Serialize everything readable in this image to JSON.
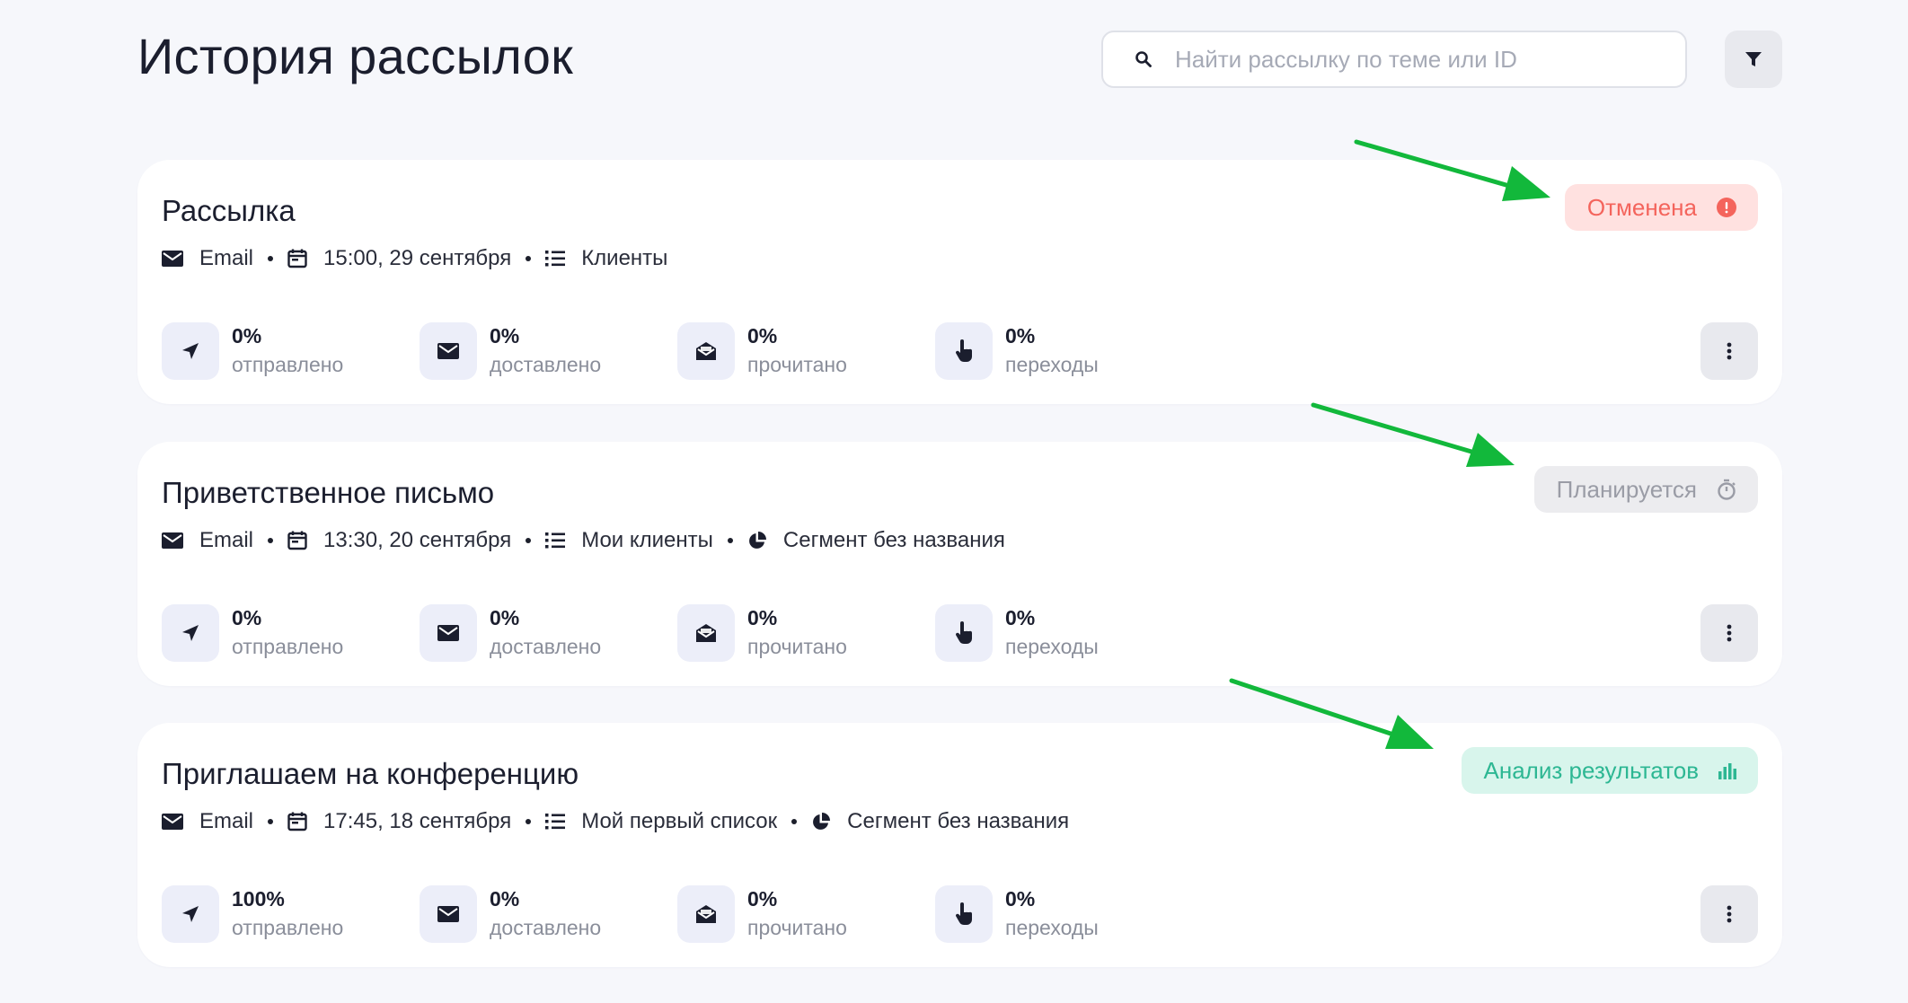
{
  "header": {
    "title": "История рассылок",
    "search_placeholder": "Найти рассылку по теме или ID"
  },
  "icons": {
    "search": "search-icon",
    "filter": "filter-icon",
    "more": "more-vertical-icon",
    "sent": "send-icon",
    "delivered": "envelope-icon",
    "read": "envelope-open-icon",
    "clicks": "pointer-hand-icon"
  },
  "colors": {
    "cancelled": "#f4645c",
    "planned": "#9a9ca6",
    "analysis": "#2db793",
    "arrow": "#12b83b"
  },
  "campaigns": [
    {
      "title": "Рассылка",
      "status": "Отменена",
      "channel": "Email",
      "datetime": "15:00, 29 сентября",
      "list": "Клиенты",
      "segment": "",
      "stats": [
        {
          "value": "0%",
          "label": "отправлено"
        },
        {
          "value": "0%",
          "label": "доставлено"
        },
        {
          "value": "0%",
          "label": "прочитано"
        },
        {
          "value": "0%",
          "label": "переходы"
        }
      ]
    },
    {
      "title": "Приветственное письмо",
      "status": "Планируется",
      "channel": "Email",
      "datetime": "13:30, 20 сентября",
      "list": "Мои клиенты",
      "segment": "Сегмент без названия",
      "stats": [
        {
          "value": "0%",
          "label": "отправлено"
        },
        {
          "value": "0%",
          "label": "доставлено"
        },
        {
          "value": "0%",
          "label": "прочитано"
        },
        {
          "value": "0%",
          "label": "переходы"
        }
      ]
    },
    {
      "title": "Приглашаем на конференцию",
      "status": "Анализ результатов",
      "channel": "Email",
      "datetime": "17:45, 18 сентября",
      "list": "Мой первый список",
      "segment": "Сегмент без названия",
      "stats": [
        {
          "value": "100%",
          "label": "отправлено"
        },
        {
          "value": "0%",
          "label": "доставлено"
        },
        {
          "value": "0%",
          "label": "прочитано"
        },
        {
          "value": "0%",
          "label": "переходы"
        }
      ]
    }
  ]
}
